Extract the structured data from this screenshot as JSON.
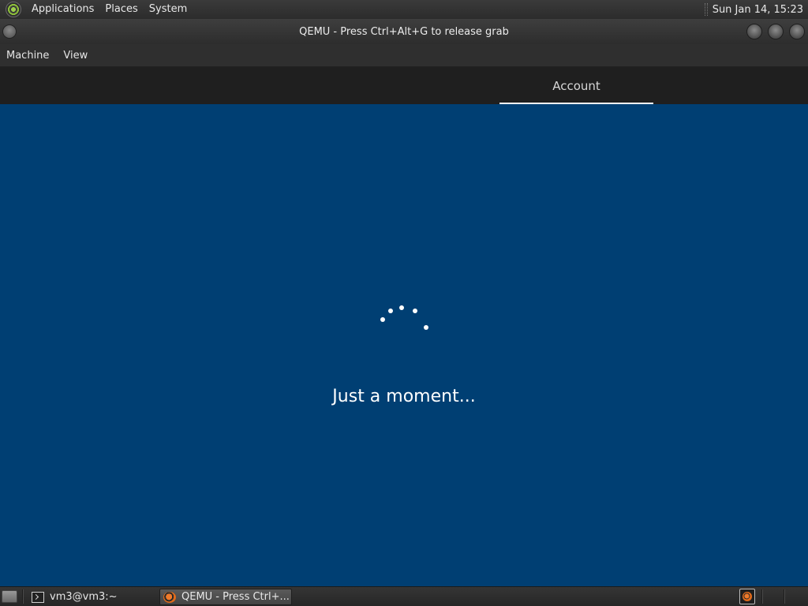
{
  "top_panel": {
    "menus": [
      "Applications",
      "Places",
      "System"
    ],
    "clock": "Sun Jan 14, 15:23"
  },
  "window": {
    "title": "QEMU - Press Ctrl+Alt+G to release grab",
    "menus": [
      "Machine",
      "View"
    ]
  },
  "guest": {
    "header_tab": "Account",
    "status": "Just a moment..."
  },
  "taskbar": {
    "tasks": [
      {
        "label": "vm3@vm3:~",
        "icon": "terminal-icon"
      },
      {
        "label": "QEMU - Press Ctrl+...",
        "icon": "qemu-icon",
        "active": true
      }
    ],
    "tray": [
      {
        "icon": "qemu-icon"
      }
    ]
  },
  "colors": {
    "guest_background": "#003f73",
    "oobe_header": "#1f1f1f",
    "panel": "#2f2f2f"
  }
}
